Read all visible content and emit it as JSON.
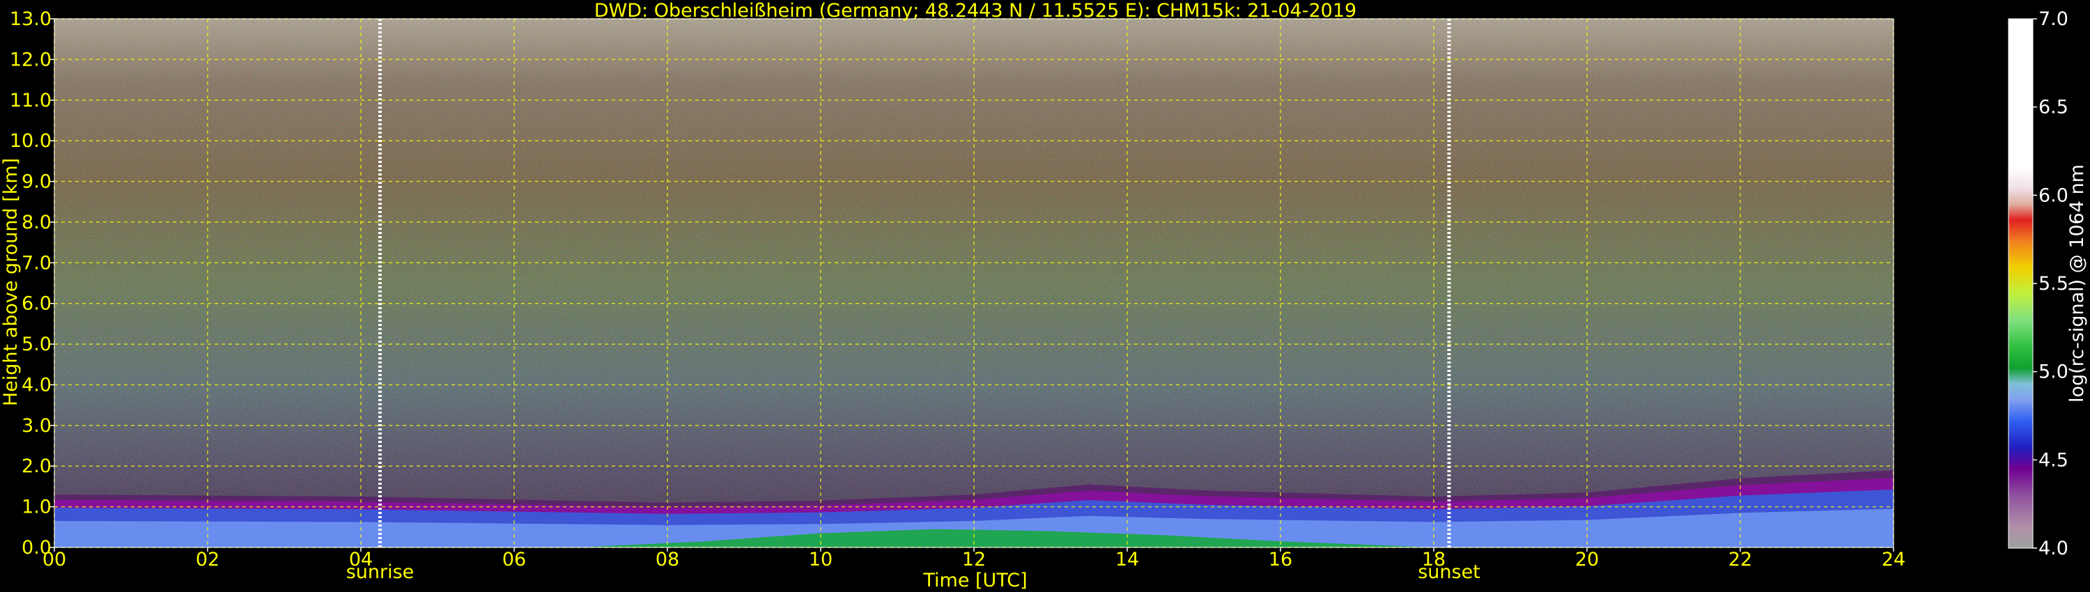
{
  "chart_data": {
    "type": "heatmap",
    "title": "DWD: Oberschleißheim (Germany; 48.2443 N / 11.5525 E):    CHM15k: 21-04-2019",
    "xlabel": "Time [UTC]",
    "ylabel": "Height above ground [km]",
    "xlim": [
      0,
      24
    ],
    "ylim": [
      0,
      13
    ],
    "x_ticks": [
      "00",
      "02",
      "04",
      "06",
      "08",
      "10",
      "12",
      "14",
      "16",
      "18",
      "20",
      "22",
      "24"
    ],
    "y_ticks": [
      "0.0",
      "1.0",
      "2.0",
      "3.0",
      "4.0",
      "5.0",
      "6.0",
      "7.0",
      "8.0",
      "9.0",
      "10.0",
      "11.0",
      "12.0",
      "13.0"
    ],
    "grid": true,
    "markers": [
      {
        "label": "sunrise",
        "time": 4.25
      },
      {
        "label": "sunset",
        "time": 18.2
      }
    ],
    "colorbar": {
      "label": "log(rc-signal) @ 1064 nm",
      "range": [
        4.0,
        7.0
      ],
      "ticks": [
        "4.0",
        "4.5",
        "5.0",
        "5.5",
        "6.0",
        "6.5",
        "7.0"
      ]
    },
    "boundary_layer_top_km": [
      {
        "time": 0,
        "height": 1.3
      },
      {
        "time": 4,
        "height": 1.25
      },
      {
        "time": 8,
        "height": 1.1
      },
      {
        "time": 10,
        "height": 1.15
      },
      {
        "time": 12,
        "height": 1.3
      },
      {
        "time": 13.5,
        "height": 1.55
      },
      {
        "time": 15,
        "height": 1.4
      },
      {
        "time": 18,
        "height": 1.25
      },
      {
        "time": 20,
        "height": 1.35
      },
      {
        "time": 22,
        "height": 1.7
      },
      {
        "time": 24,
        "height": 1.9
      }
    ]
  },
  "colors": {
    "text": "#ffff00",
    "grid": "#ffff00",
    "marker": "#ffffff",
    "background": "#000000"
  }
}
